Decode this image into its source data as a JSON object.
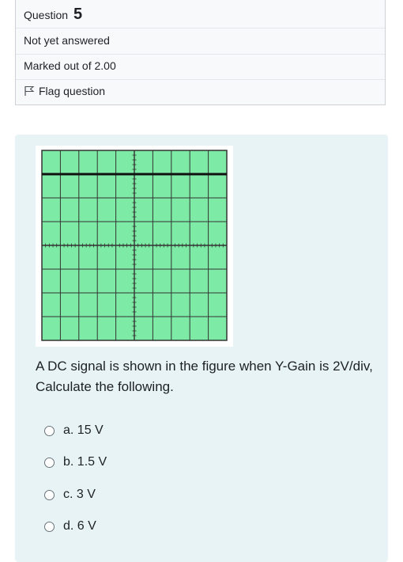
{
  "question": {
    "label": "Question",
    "number": "5",
    "status": "Not yet answered",
    "marks": "Marked out of 2.00",
    "flag_label": "Flag question"
  },
  "prompt": {
    "text": "A DC signal is shown in the figure when Y-Gain is 2V/div, Calculate the following."
  },
  "figure": {
    "grid_color": "#7deba5",
    "line_color": "#333333",
    "signal_color": "#111111",
    "columns": 10,
    "rows": 8,
    "signal_level_divisions_above_center": 3
  },
  "options": [
    {
      "letter": "a.",
      "value": "15 V"
    },
    {
      "letter": "b.",
      "value": "1.5 V"
    },
    {
      "letter": "c.",
      "value": "3 V"
    },
    {
      "letter": "d.",
      "value": "6 V"
    }
  ]
}
